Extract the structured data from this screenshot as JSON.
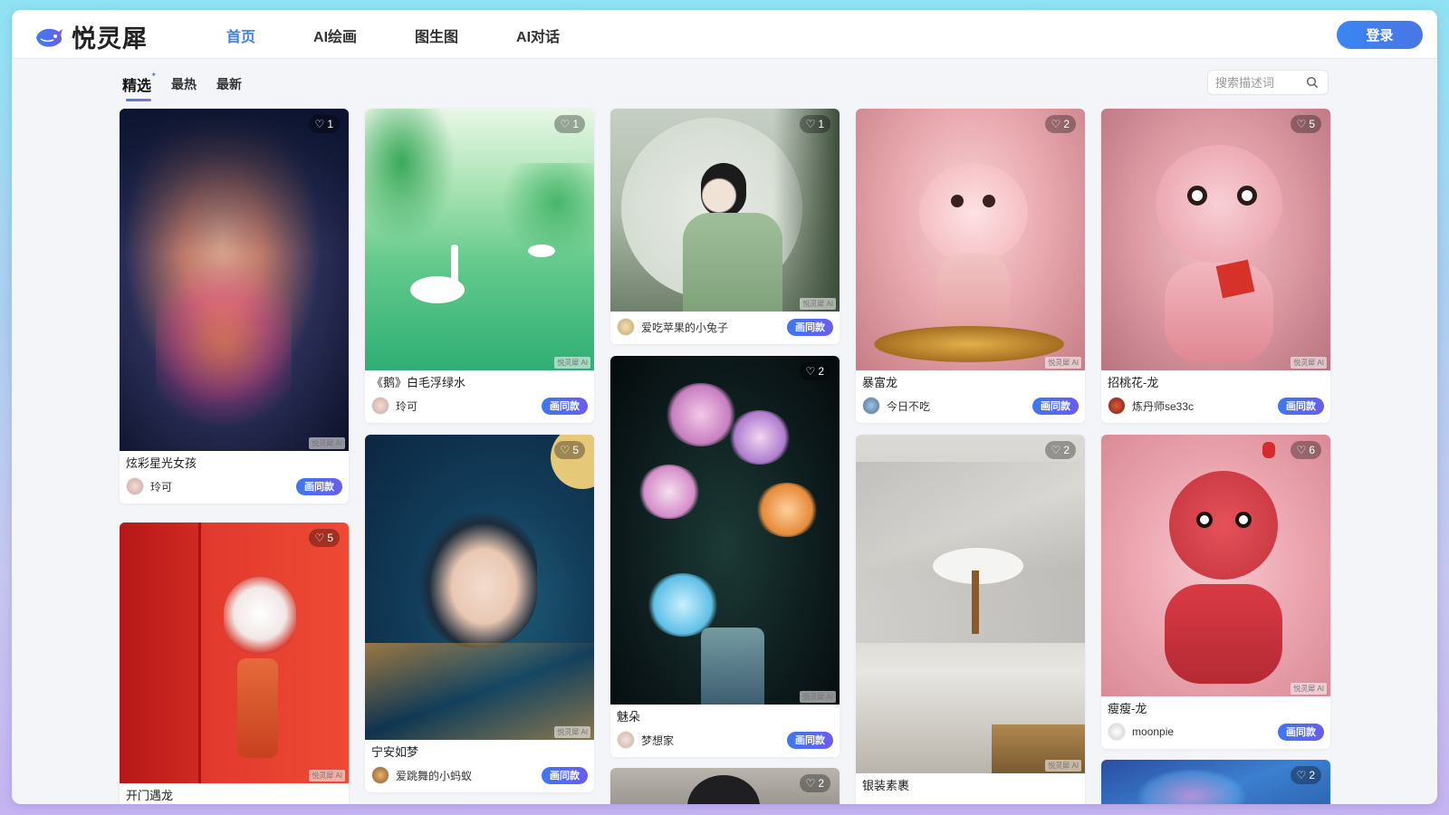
{
  "app": {
    "logo_text": "悦灵犀"
  },
  "nav": [
    {
      "label": "首页",
      "active": true
    },
    {
      "label": "AI绘画",
      "active": false
    },
    {
      "label": "图生图",
      "active": false
    },
    {
      "label": "AI对话",
      "active": false
    }
  ],
  "header": {
    "login_label": "登录"
  },
  "filters": [
    {
      "label": "精选",
      "active": true
    },
    {
      "label": "最热",
      "active": false
    },
    {
      "label": "最新",
      "active": false
    }
  ],
  "search": {
    "placeholder": "搜索描述词"
  },
  "watermark": "悦灵犀 AI",
  "same_style_label": "画同款",
  "columns": [
    [
      {
        "title": "炫彩星光女孩",
        "user": "玲可",
        "likes": "1",
        "image": "glitter-girl"
      },
      {
        "title": "开门遇龙",
        "user": "",
        "likes": "5",
        "image": "red-door-lion"
      }
    ],
    [
      {
        "title": "《鹅》白毛浮绿水",
        "user": "玲可",
        "likes": "1",
        "image": "green-swans"
      },
      {
        "title": "宁安如梦",
        "user": "爱跳舞的小蚂蚁",
        "likes": "5",
        "image": "dreaming-lady"
      }
    ],
    [
      {
        "title": "",
        "user": "爱吃苹果的小兔子",
        "likes": "1",
        "image": "ink-lady"
      },
      {
        "title": "魅朵",
        "user": "梦想家",
        "likes": "2",
        "image": "crystal-flowers"
      },
      {
        "title": "",
        "user": "",
        "likes": "2",
        "image": "partial"
      }
    ],
    [
      {
        "title": "暴富龙",
        "user": "今日不吃",
        "likes": "2",
        "image": "rich-dragon"
      },
      {
        "title": "银装素裹",
        "user": "",
        "likes": "2",
        "image": "snow-mountain"
      }
    ],
    [
      {
        "title": "招桃花-龙",
        "user": "炼丹师se33c",
        "likes": "5",
        "image": "peach-dragon"
      },
      {
        "title": "瘦瘦-龙",
        "user": "moonpie",
        "likes": "6",
        "image": "red-dragon"
      },
      {
        "title": "",
        "user": "",
        "likes": "2",
        "image": "blue-dragon"
      }
    ]
  ]
}
